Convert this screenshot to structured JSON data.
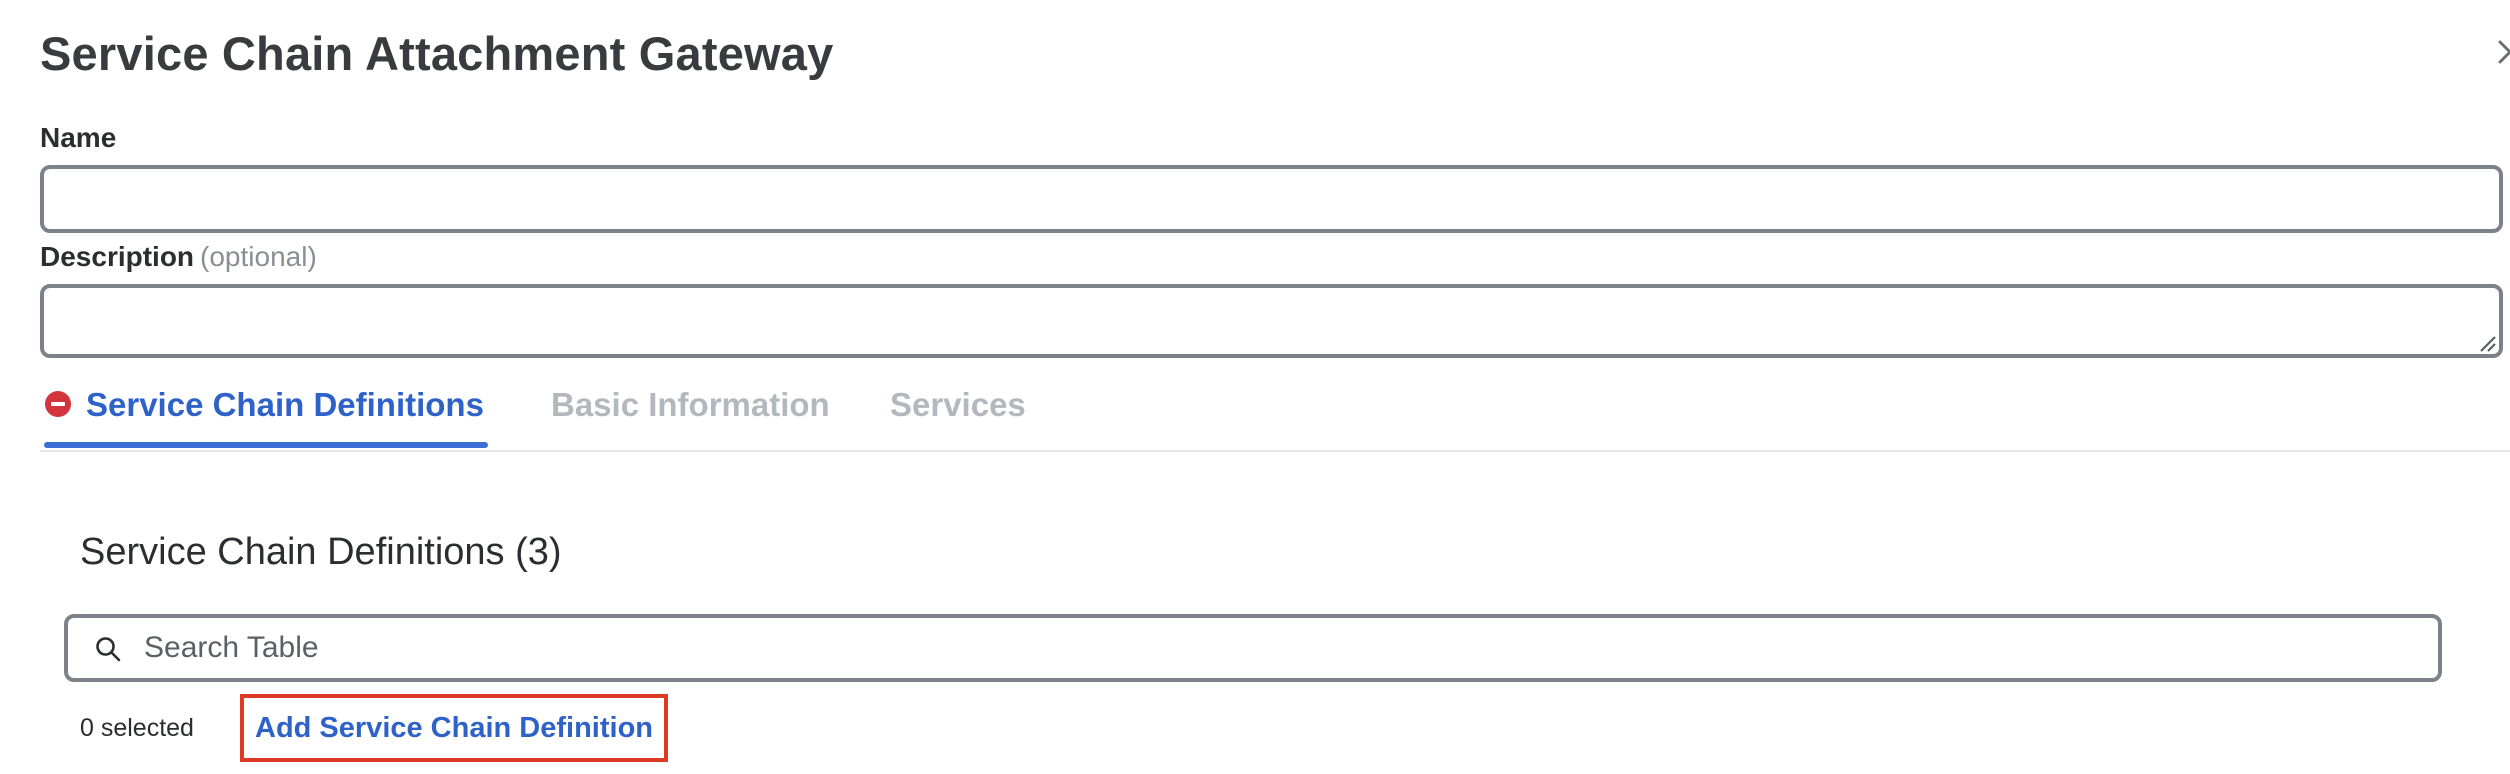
{
  "dialog": {
    "title": "Service Chain Attachment Gateway"
  },
  "form": {
    "name_label": "Name",
    "name_value": "",
    "description_label": "Description",
    "description_optional": "(optional)",
    "description_value": ""
  },
  "tabs": [
    {
      "label": "Service Chain Definitions",
      "active": true,
      "status_icon": "error-icon"
    },
    {
      "label": "Basic Information",
      "active": false
    },
    {
      "label": "Services",
      "active": false
    }
  ],
  "section": {
    "heading": "Service Chain Definitions (3)",
    "search_placeholder": "Search Table",
    "selected_text": "0 selected",
    "add_button_label": "Add Service Chain Definition"
  },
  "colors": {
    "accent": "#2f62c9",
    "error": "#d4343b",
    "highlight_border": "#e03a24",
    "inactive_tab": "#b3b7be"
  }
}
